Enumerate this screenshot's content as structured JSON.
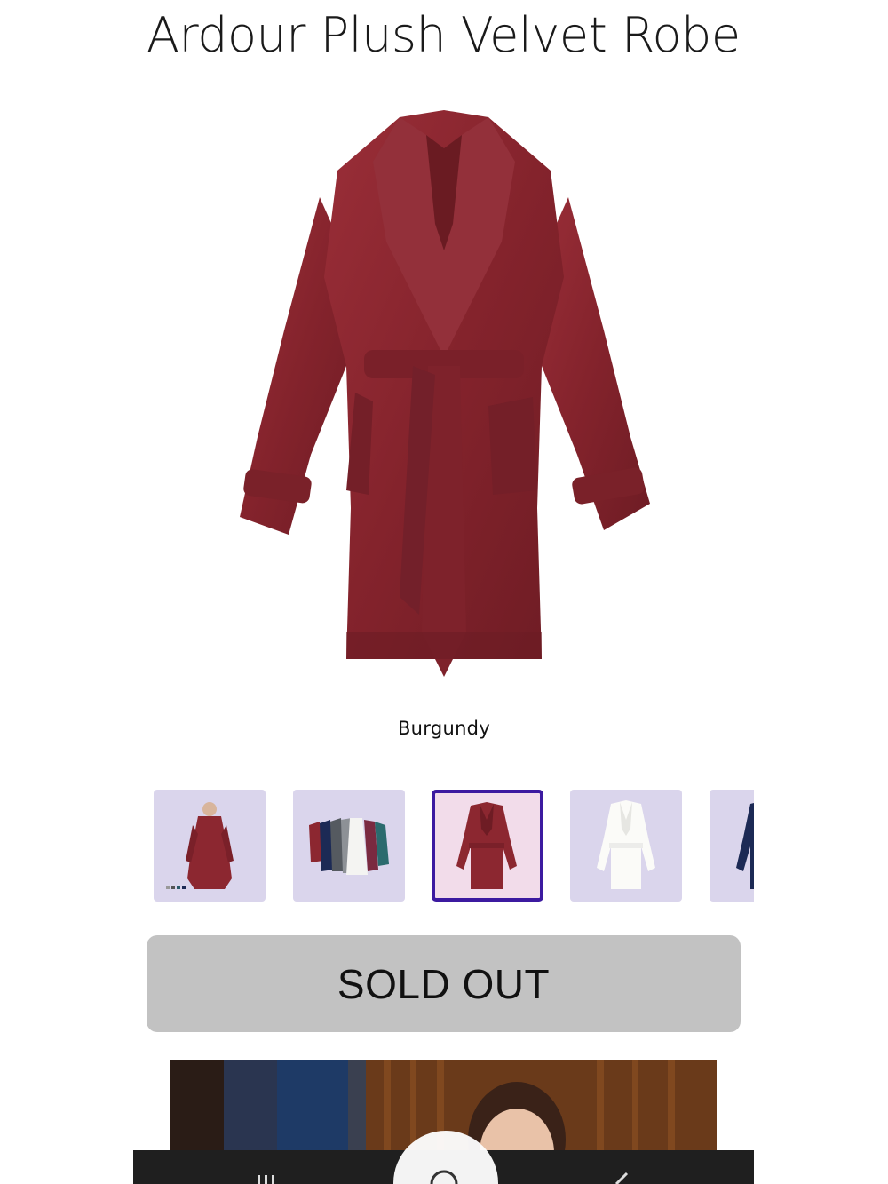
{
  "product": {
    "title": "Ardour Plush Velvet Robe",
    "selected_color": "Burgundy"
  },
  "gallery": {
    "thumbnails": [
      {
        "name": "model-wearing-burgundy",
        "selected": false
      },
      {
        "name": "all-colors-lineup",
        "selected": false
      },
      {
        "name": "burgundy-robe",
        "selected": true
      },
      {
        "name": "white-robe",
        "selected": false
      },
      {
        "name": "navy-robe",
        "selected": false
      }
    ]
  },
  "actions": {
    "sold_out_label": "SOLD OUT"
  },
  "colors": {
    "burgundy": "#8c2730",
    "thumb_bg": "#dad5ec",
    "selected_border": "#3c1aa0",
    "button_bg": "#c2c2c2"
  },
  "system_nav": {
    "icons": [
      "recent-apps-icon",
      "home-icon",
      "back-icon"
    ]
  }
}
